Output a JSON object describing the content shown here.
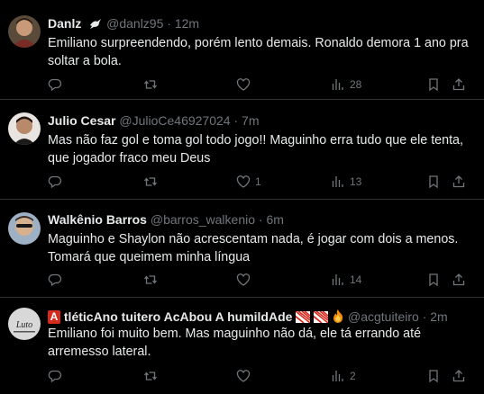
{
  "tweets": [
    {
      "name": "Danlz",
      "badge_icon": "dove-icon",
      "handle": "@danlz95",
      "time": "12m",
      "lines": [
        "Emiliano surpreendendo, porém lento demais. Ronaldo demora 1 ano pra",
        "soltar a bola."
      ],
      "replies": "",
      "retweets": "",
      "likes": "",
      "views": "28"
    },
    {
      "name": "Julio Cesar",
      "handle": "@JulioCe46927024",
      "time": "7m",
      "lines": [
        "Mas não faz gol e toma gol todo jogo!! Maguinho erra tudo que ele tenta,",
        "que jogador fraco meu Deus"
      ],
      "replies": "",
      "retweets": "",
      "likes": "1",
      "views": "13"
    },
    {
      "name": "Walkênio Barros",
      "handle": "@barros_walkenio",
      "time": "6m",
      "lines": [
        "Maguinho e Shaylon não acrescentam nada, é jogar com dois a menos.",
        "Tomará que queimem minha língua"
      ],
      "replies": "",
      "retweets": "",
      "likes": "",
      "views": "14"
    },
    {
      "name_parts": [
        "A",
        "tléticAno tuitero AcAbou A humildAde"
      ],
      "name_prefix_icon": "letter-a-red-square-icon",
      "name_suffix_icons": [
        "striped-flag-icon",
        "striped-flag-icon",
        "fire-icon"
      ],
      "handle": "@acgtuiteiro",
      "time": "2m",
      "lines": [
        "Emiliano foi muito bem. Mas maguinho não dá, ele tá errando até",
        "arremesso lateral."
      ],
      "replies": "",
      "retweets": "",
      "likes": "",
      "views": "2"
    }
  ],
  "separator": "·",
  "colors": {
    "background": "#000000",
    "text": "#e7e9ea",
    "muted": "#71767b",
    "border": "#2f3336",
    "badge_red": "#d52b1e"
  }
}
